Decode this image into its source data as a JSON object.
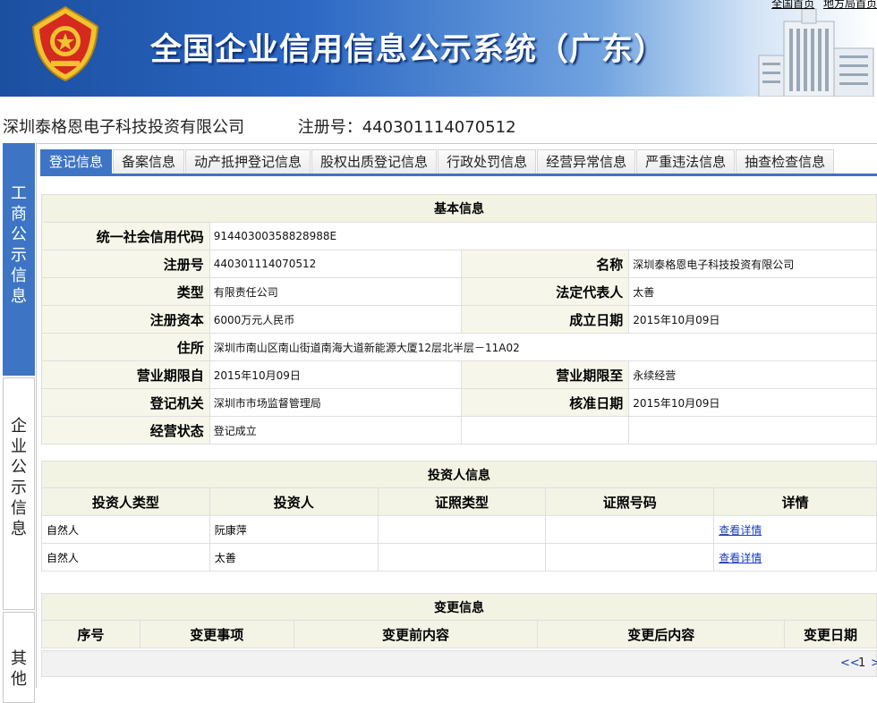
{
  "header": {
    "title": "全国企业信用信息公示系统（广东）",
    "links": [
      "全国首页",
      "地方局首页"
    ]
  },
  "company": {
    "name": "深圳泰格恩电子科技投资有限公司",
    "reg_label": "注册号：440301114070512"
  },
  "side_tabs": [
    {
      "label": "工商公示信息",
      "active": true
    },
    {
      "label": "企业公示信息",
      "active": false
    },
    {
      "label": "其他"
    }
  ],
  "tabs": [
    "登记信息",
    "备案信息",
    "动产抵押登记信息",
    "股权出质登记信息",
    "行政处罚信息",
    "经营异常信息",
    "严重违法信息",
    "抽查检查信息"
  ],
  "basic": {
    "title": "基本信息",
    "credit_code_label": "统一社会信用代码",
    "credit_code": "91440300358828988E",
    "reg_no_label": "注册号",
    "reg_no": "440301114070512",
    "name_label": "名称",
    "name": "深圳泰格恩电子科技投资有限公司",
    "type_label": "类型",
    "type": "有限责任公司",
    "legal_rep_label": "法定代表人",
    "legal_rep": "太善",
    "capital_label": "注册资本",
    "capital": "6000万元人民币",
    "est_date_label": "成立日期",
    "est_date": "2015年10月09日",
    "address_label": "住所",
    "address": "深圳市南山区南山街道南海大道新能源大厦12层北半层－11A02",
    "term_from_label": "营业期限自",
    "term_from": "2015年10月09日",
    "term_to_label": "营业期限至",
    "term_to": "永续经营",
    "authority_label": "登记机关",
    "authority": "深圳市市场监督管理局",
    "approval_date_label": "核准日期",
    "approval_date": "2015年10月09日",
    "status_label": "经营状态",
    "status": "登记成立"
  },
  "investors": {
    "title": "投资人信息",
    "columns": [
      "投资人类型",
      "投资人",
      "证照类型",
      "证照号码",
      "详情"
    ],
    "rows": [
      {
        "type": "自然人",
        "name": "阮康萍",
        "id_type": "",
        "id_no": "",
        "detail": "查看详情"
      },
      {
        "type": "自然人",
        "name": "太善",
        "id_type": "",
        "id_no": "",
        "detail": "查看详情"
      }
    ]
  },
  "changes": {
    "title": "变更信息",
    "columns": [
      "序号",
      "变更事项",
      "变更前内容",
      "变更后内容",
      "变更日期"
    ]
  },
  "pager": {
    "prev": "<<",
    "page": "1",
    "next": ">"
  },
  "colors": {
    "accent": "#3d75c4",
    "header_dark": "#1b4fa0",
    "label_bg": "#f6f7ea",
    "emblem_red": "#d42a20",
    "emblem_gold": "#f2c230"
  },
  "icons": [
    "national-emblem-icon",
    "building-illustration"
  ]
}
